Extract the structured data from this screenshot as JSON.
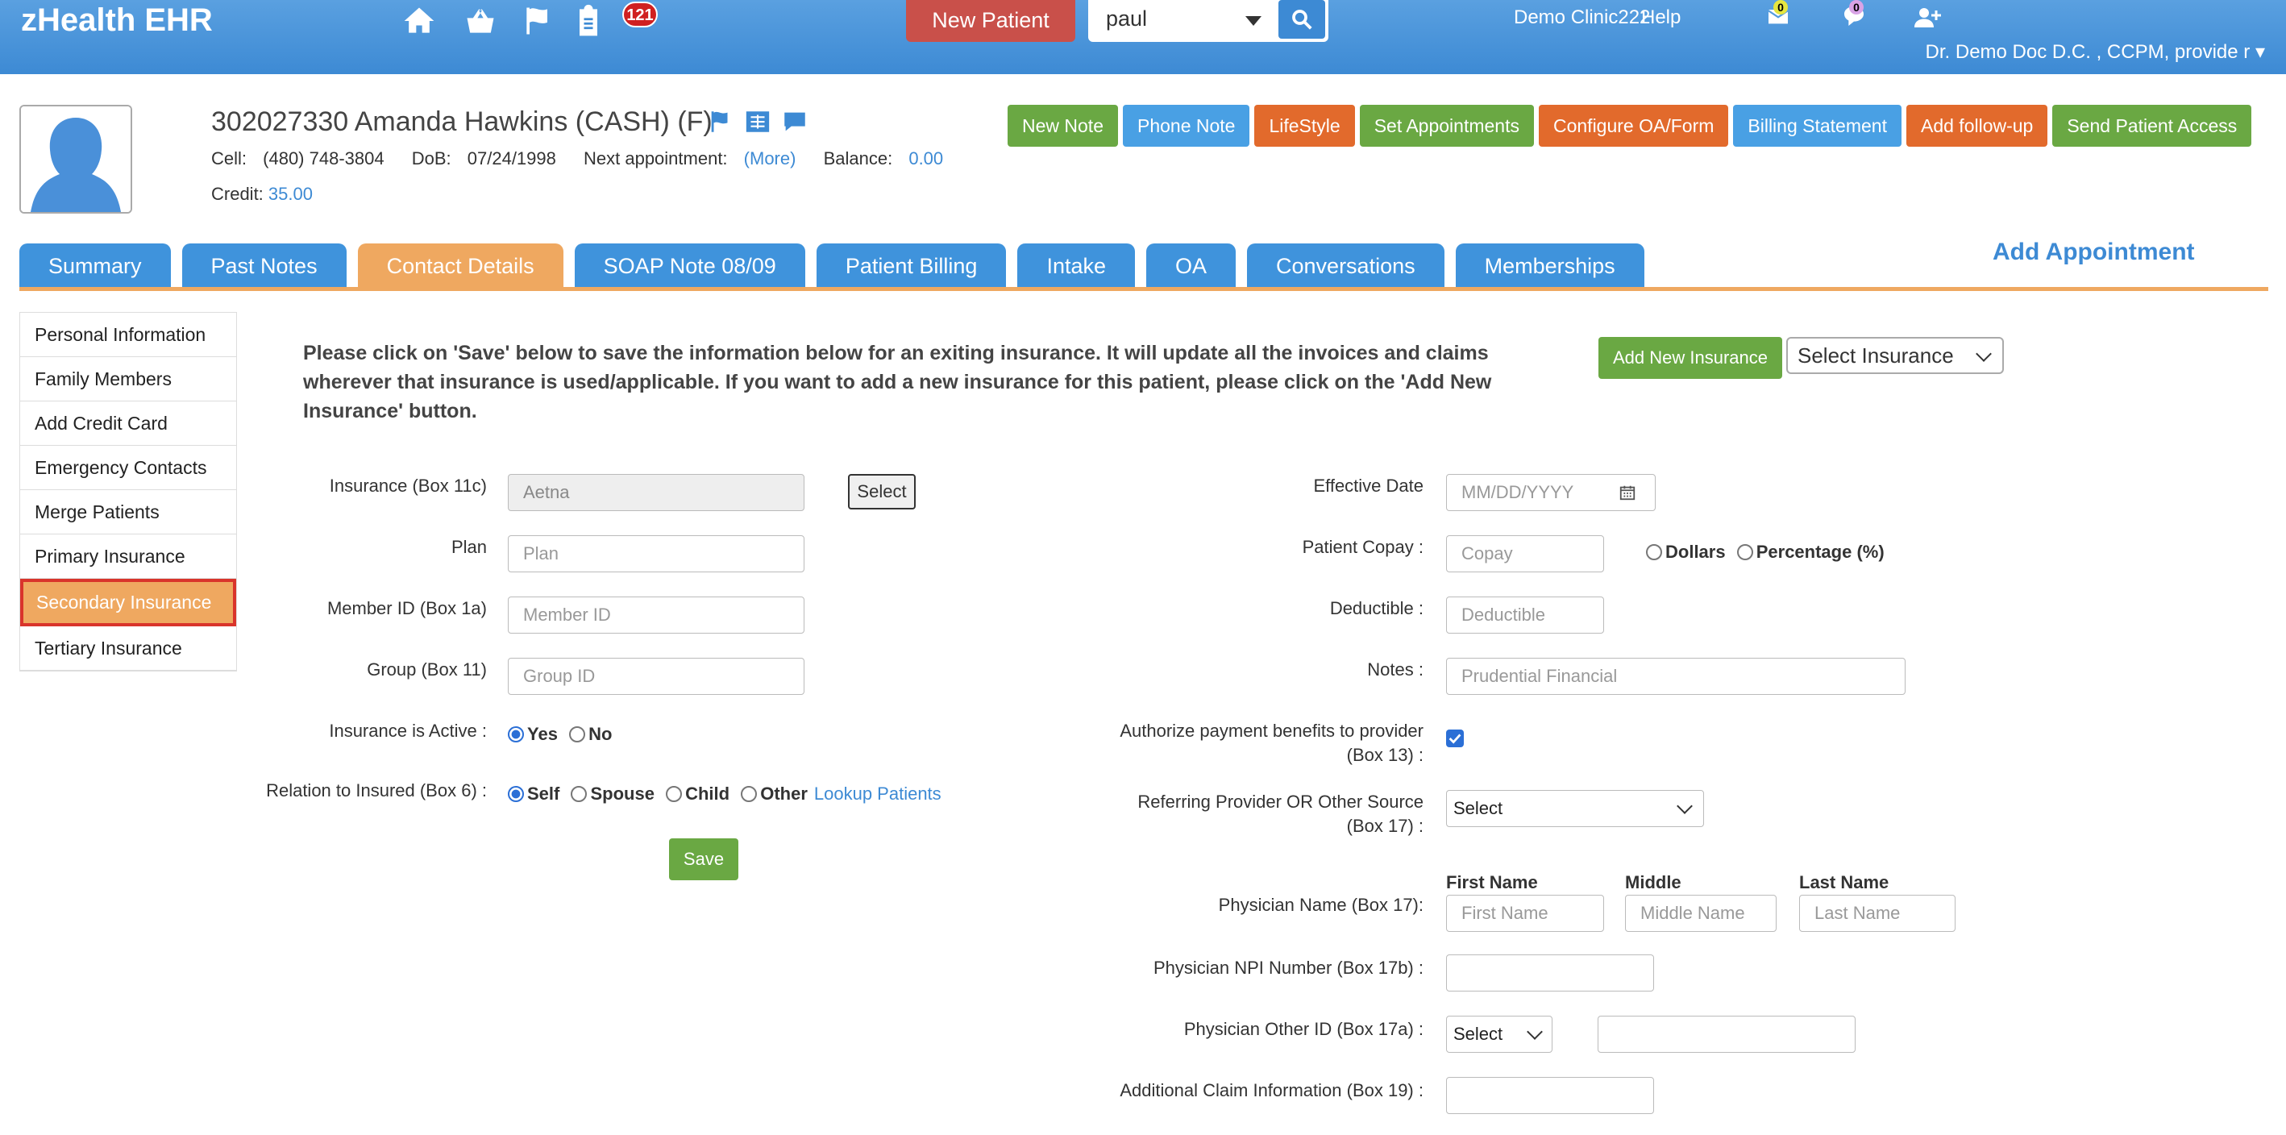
{
  "app": {
    "title": "zHealth EHR",
    "nav_badge": "121",
    "new_patient": "New Patient",
    "search_value": "paul",
    "clinic": "Demo Clinic222",
    "help": "Help",
    "msg_badge": "0",
    "chat_badge": "0",
    "user": "Dr. Demo Doc D.C. , CCPM, provide r ▾"
  },
  "patient": {
    "name": "302027330 Amanda Hawkins  (CASH) (F)",
    "cell_label": "Cell:",
    "cell": "(480) 748-3804",
    "dob_label": "DoB:",
    "dob": "07/24/1998",
    "next_appt_label": "Next appointment:",
    "more": "(More)",
    "balance_label": "Balance:",
    "balance": "0.00",
    "credit_label": "Credit:",
    "credit": "35.00"
  },
  "actions": [
    "New Note",
    "Phone Note",
    "LifeStyle",
    "Set Appointments",
    "Configure OA/Form",
    "Billing Statement",
    "Add follow-up",
    "Send Patient Access"
  ],
  "tabs": [
    "Summary",
    "Past Notes",
    "Contact Details",
    "SOAP Note 08/09",
    "Patient Billing",
    "Intake",
    "OA",
    "Conversations",
    "Memberships"
  ],
  "add_appointment": "Add Appointment",
  "sidenav": [
    "Personal Information",
    "Family Members",
    "Add Credit Card",
    "Emergency Contacts",
    "Merge Patients",
    "Primary Insurance",
    "Secondary Insurance",
    "Tertiary Insurance"
  ],
  "notice": "Please click on 'Save' below to save the information below for an exiting insurance. It will update all the invoices and claims wherever that insurance is used/applicable. If you want to add a new insurance for this patient, please click on the 'Add New Insurance' button.",
  "add_new_insurance": "Add New Insurance",
  "select_insurance": "Select Insurance",
  "form_left": {
    "insurance_label": "Insurance (Box 11c)",
    "insurance_value": "Aetna",
    "select_btn": "Select",
    "plan_label": "Plan",
    "plan_ph": "Plan",
    "member_label": "Member ID (Box 1a)",
    "member_ph": "Member ID",
    "group_label": "Group (Box 11)",
    "group_ph": "Group ID",
    "active_label": "Insurance is Active :",
    "yes": "Yes",
    "no": "No",
    "relation_label": "Relation to Insured (Box 6) :",
    "self": "Self",
    "spouse": "Spouse",
    "child": "Child",
    "other": "Other",
    "lookup": "Lookup Patients",
    "save": "Save"
  },
  "form_right": {
    "eff_label": "Effective Date",
    "eff_ph": "MM/DD/YYYY",
    "copay_label": "Patient Copay :",
    "copay_ph": "Copay",
    "dollars": "Dollars",
    "percentage": "Percentage (%)",
    "deduct_label": "Deductible :",
    "deduct_ph": "Deductible",
    "notes_label": "Notes :",
    "notes_ph": "Prudential Financial",
    "auth_label1": "Authorize payment benefits to provider",
    "auth_label2": "(Box 13) :",
    "ref_label1": "Referring Provider OR Other Source",
    "ref_label2": "(Box 17) :",
    "ref_select": "Select",
    "first_head": "First Name",
    "middle_head": "Middle",
    "last_head": "Last Name",
    "phys_label": "Physician Name (Box 17):",
    "first_ph": "First Name",
    "middle_ph": "Middle Name",
    "last_ph": "Last Name",
    "npi_label": "Physician NPI Number (Box 17b) :",
    "other_id_label": "Physician Other ID (Box 17a) :",
    "other_select": "Select",
    "addl_label": "Additional Claim Information (Box 19) :"
  },
  "colors": {
    "topbar": "#3d8ad4",
    "tab": "#3f93dc",
    "tab_active": "#efa860",
    "green": "#6aa843",
    "orange": "#e26a2c",
    "blue": "#49a0e4"
  }
}
